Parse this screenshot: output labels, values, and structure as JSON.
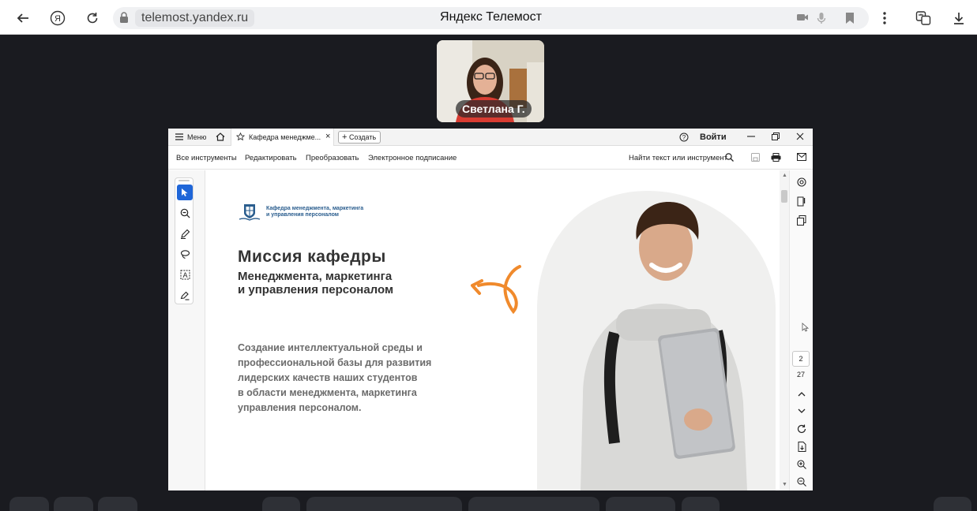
{
  "browser": {
    "url": "telemost.yandex.ru",
    "title": "Яндекс Телемост"
  },
  "call": {
    "participant_name": "Светлана Г."
  },
  "pdf": {
    "tabs": {
      "menu_label": "Меню",
      "doc_tab_label": "Кафедра менеджме...",
      "new_tab_label": "Создать",
      "login_label": "Войти"
    },
    "toolbar": {
      "all_tools": "Все инструменты",
      "edit": "Редактировать",
      "convert": "Преобразовать",
      "e_sign": "Электронное подписание",
      "search_placeholder": "Найти текст или инструмент"
    },
    "page_nav": {
      "current_page": "2",
      "total_pages": "27"
    },
    "page": {
      "logo_line1": "Кафедра менеджмента, маркетинга",
      "logo_line2": "и управления персоналом",
      "heading": "Миссия кафедры",
      "subheading_line1": "Менеджмента, маркетинга",
      "subheading_line2": "и управления персоналом",
      "body_line1": "Создание интеллектуальной среды и",
      "body_line2": "профессиональной базы для развития",
      "body_line3": "лидерских качеств наших студентов",
      "body_line4": "в области менеджмента, маркетинга",
      "body_line5": "управления персоналом."
    }
  },
  "colors": {
    "accent_orange": "#f08a2c",
    "tool_active_blue": "#1f66d8",
    "logo_blue": "#2a5d8e"
  }
}
